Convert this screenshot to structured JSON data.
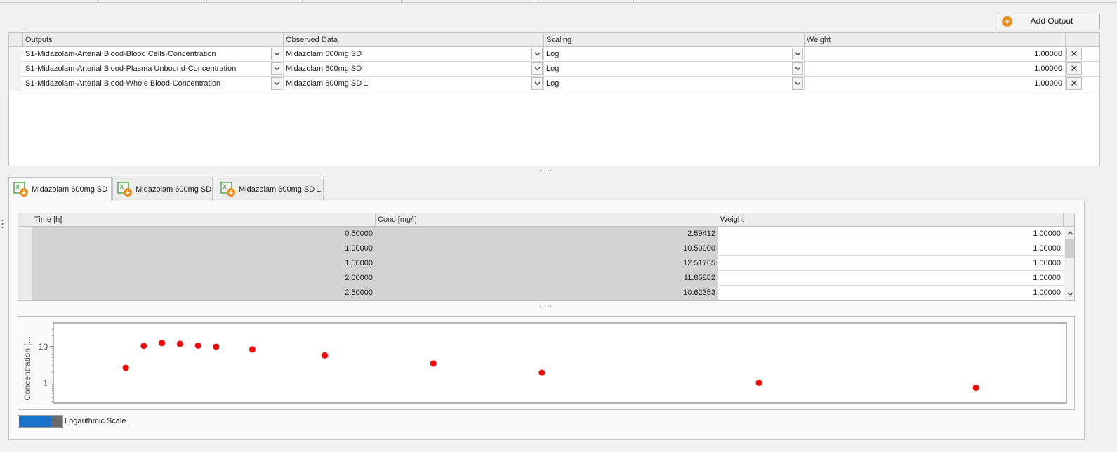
{
  "toolbar": {
    "add_output_label": "Add Output"
  },
  "outputs_grid": {
    "columns": [
      "Outputs",
      "Observed Data",
      "Scaling",
      "Weight"
    ],
    "rows": [
      {
        "output": "S1-Midazolam-Arterial Blood-Blood Cells-Concentration",
        "observed": "Midazolam 600mg SD",
        "scaling": "Log",
        "weight": "1.00000"
      },
      {
        "output": "S1-Midazolam-Arterial Blood-Plasma Unbound-Concentration",
        "observed": "Midazolam 600mg SD",
        "scaling": "Log",
        "weight": "1.00000"
      },
      {
        "output": "S1-Midazolam-Arterial Blood-Whole Blood-Concentration",
        "observed": "Midazolam 600mg SD 1",
        "scaling": "Log",
        "weight": "1.00000"
      }
    ]
  },
  "splitter": "·····",
  "tabs": [
    {
      "label": "Midazolam 600mg SD",
      "active": true
    },
    {
      "label": "Midazolam 600mg SD",
      "active": false
    },
    {
      "label": "Midazolam 600mg SD 1",
      "active": false
    }
  ],
  "data_grid": {
    "columns": [
      "Time [h]",
      "Conc [mg/l]",
      "Weight"
    ],
    "rows": [
      {
        "time": "0.50000",
        "conc": "2.59412",
        "weight": "1.00000"
      },
      {
        "time": "1.00000",
        "conc": "10.50000",
        "weight": "1.00000"
      },
      {
        "time": "1.50000",
        "conc": "12.51765",
        "weight": "1.00000"
      },
      {
        "time": "2.00000",
        "conc": "11.85882",
        "weight": "1.00000"
      },
      {
        "time": "2.50000",
        "conc": "10.62353",
        "weight": "1.00000"
      }
    ]
  },
  "chart_data": {
    "type": "scatter",
    "ylabel": "Concentration [...",
    "yscale": "log",
    "y_ticks": [
      "10",
      "1"
    ],
    "series": [
      {
        "color": "#ff0000",
        "x": [
          0.5,
          1.0,
          1.5,
          2.0,
          2.5,
          3.0,
          4.0,
          6.0,
          9.0,
          12.0,
          18.0,
          24.0
        ],
        "y": [
          2.59412,
          10.5,
          12.51765,
          11.85882,
          10.62353,
          9.9,
          8.3,
          5.7,
          3.4,
          1.9,
          1.0,
          0.73
        ]
      }
    ],
    "xlim": [
      -1.5,
      26.5
    ],
    "ylim": [
      0.28,
      45
    ],
    "grid": false
  },
  "toggle": {
    "label": "Logarithmic Scale",
    "on": true
  },
  "colors": {
    "accent": "#1a73c8",
    "plus": "#f08c1a",
    "marker": "#ff0000",
    "excel_green": "#3aa13a"
  }
}
